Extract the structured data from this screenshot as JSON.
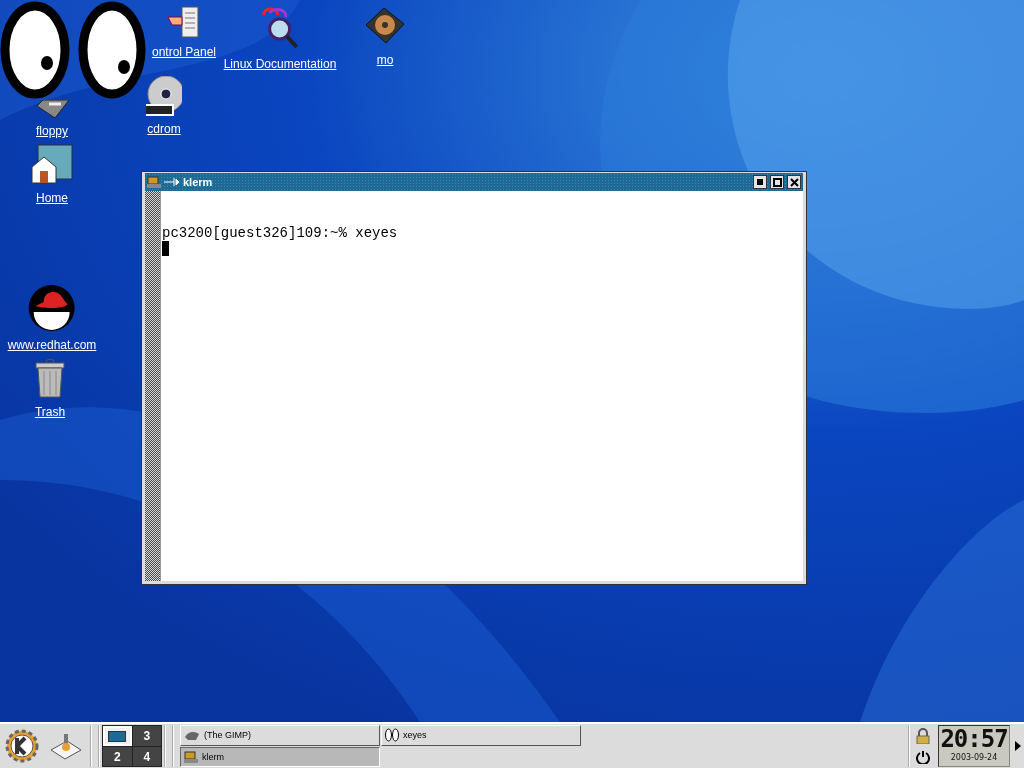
{
  "desktop": {
    "icons": [
      {
        "kind": "control",
        "label": "ontrol Panel"
      },
      {
        "kind": "docs",
        "label": "Linux Documentation"
      },
      {
        "kind": "disk",
        "label": "mo"
      },
      {
        "kind": "floppy",
        "label": "floppy"
      },
      {
        "kind": "cd",
        "label": "cdrom"
      },
      {
        "kind": "home",
        "label": "Home"
      },
      {
        "kind": "redhat",
        "label": "www.redhat.com"
      },
      {
        "kind": "trash",
        "label": "Trash"
      }
    ]
  },
  "terminal": {
    "title": "klerm",
    "lines": [
      "pc3200[guest326]109:~% xeyes"
    ]
  },
  "panel": {
    "pager": [
      {
        "selected": true
      },
      {
        "label": "3",
        "selected": false
      },
      {
        "label": "2",
        "selected": false
      },
      {
        "label": "4",
        "selected": false
      }
    ],
    "tasks": [
      {
        "kind": "gimp",
        "label": "(The GIMP)",
        "active": false
      },
      {
        "kind": "eyes",
        "label": "xeyes",
        "active": false
      },
      {
        "kind": "term",
        "label": "klerm",
        "active": true
      }
    ],
    "clock": {
      "time": "20:57",
      "date": "2003-09-24"
    }
  }
}
